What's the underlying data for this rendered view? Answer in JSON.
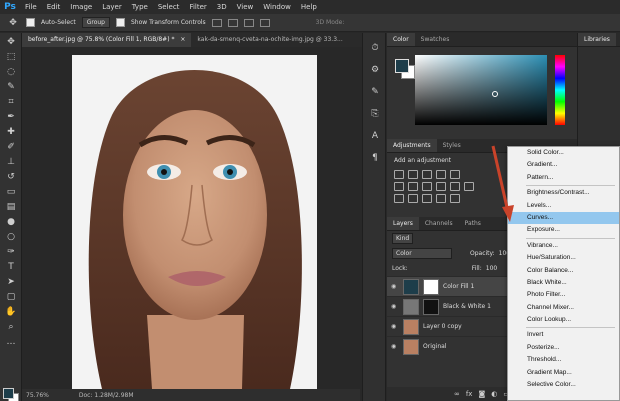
{
  "app": {
    "logo": "Ps"
  },
  "menu": [
    "File",
    "Edit",
    "Image",
    "Layer",
    "Type",
    "Select",
    "Filter",
    "3D",
    "View",
    "Window",
    "Help"
  ],
  "options": {
    "auto_select": "Auto-Select",
    "group": "Group",
    "show_transform": "Show Transform Controls",
    "mode_3d": "3D Mode:"
  },
  "tabs": [
    {
      "label": "before_after.jpg @ 75.8% (Color Fill 1, RGB/8#) *",
      "close": "×"
    },
    {
      "label": "kak-da-smenq-cveta-na-ochite-img.jpg @ 33.3..."
    }
  ],
  "status": {
    "zoom": "75.76%",
    "doc": "Doc: 1.28M/2.98M"
  },
  "color_panel": {
    "tabs": [
      "Color",
      "Swatches"
    ],
    "fg": "#1d3d4a",
    "bg": "#ffffff"
  },
  "adjustments_panel": {
    "tabs": [
      "Adjustments",
      "Styles"
    ],
    "title": "Add an adjustment"
  },
  "layers_panel": {
    "tabs": [
      "Layers",
      "Channels",
      "Paths"
    ],
    "kind": "Kind",
    "blend": "Color",
    "opacity_label": "Opacity:",
    "opacity_value": "100",
    "lock_label": "Lock:",
    "fill_label": "Fill:",
    "fill_value": "100",
    "layers": [
      {
        "name": "Color Fill 1",
        "active": true
      },
      {
        "name": "Black & White 1",
        "active": false
      },
      {
        "name": "Layer 0 copy",
        "active": false
      },
      {
        "name": "Original",
        "active": false
      }
    ]
  },
  "libraries": {
    "tab": "Libraries"
  },
  "adjustment_menu": {
    "groups": [
      [
        "Solid Color...",
        "Gradient...",
        "Pattern..."
      ],
      [
        "Brightness/Contrast...",
        "Levels...",
        "Curves...",
        "Exposure..."
      ],
      [
        "Vibrance...",
        "Hue/Saturation...",
        "Color Balance...",
        "Black  White...",
        "Photo Filter...",
        "Channel Mixer...",
        "Color Lookup..."
      ],
      [
        "Invert",
        "Posterize...",
        "Threshold...",
        "Gradient Map...",
        "Selective Color..."
      ]
    ],
    "highlighted": "Curves..."
  },
  "colors": {
    "arrow": "#c9432a",
    "highlight": "#93c7ee"
  }
}
